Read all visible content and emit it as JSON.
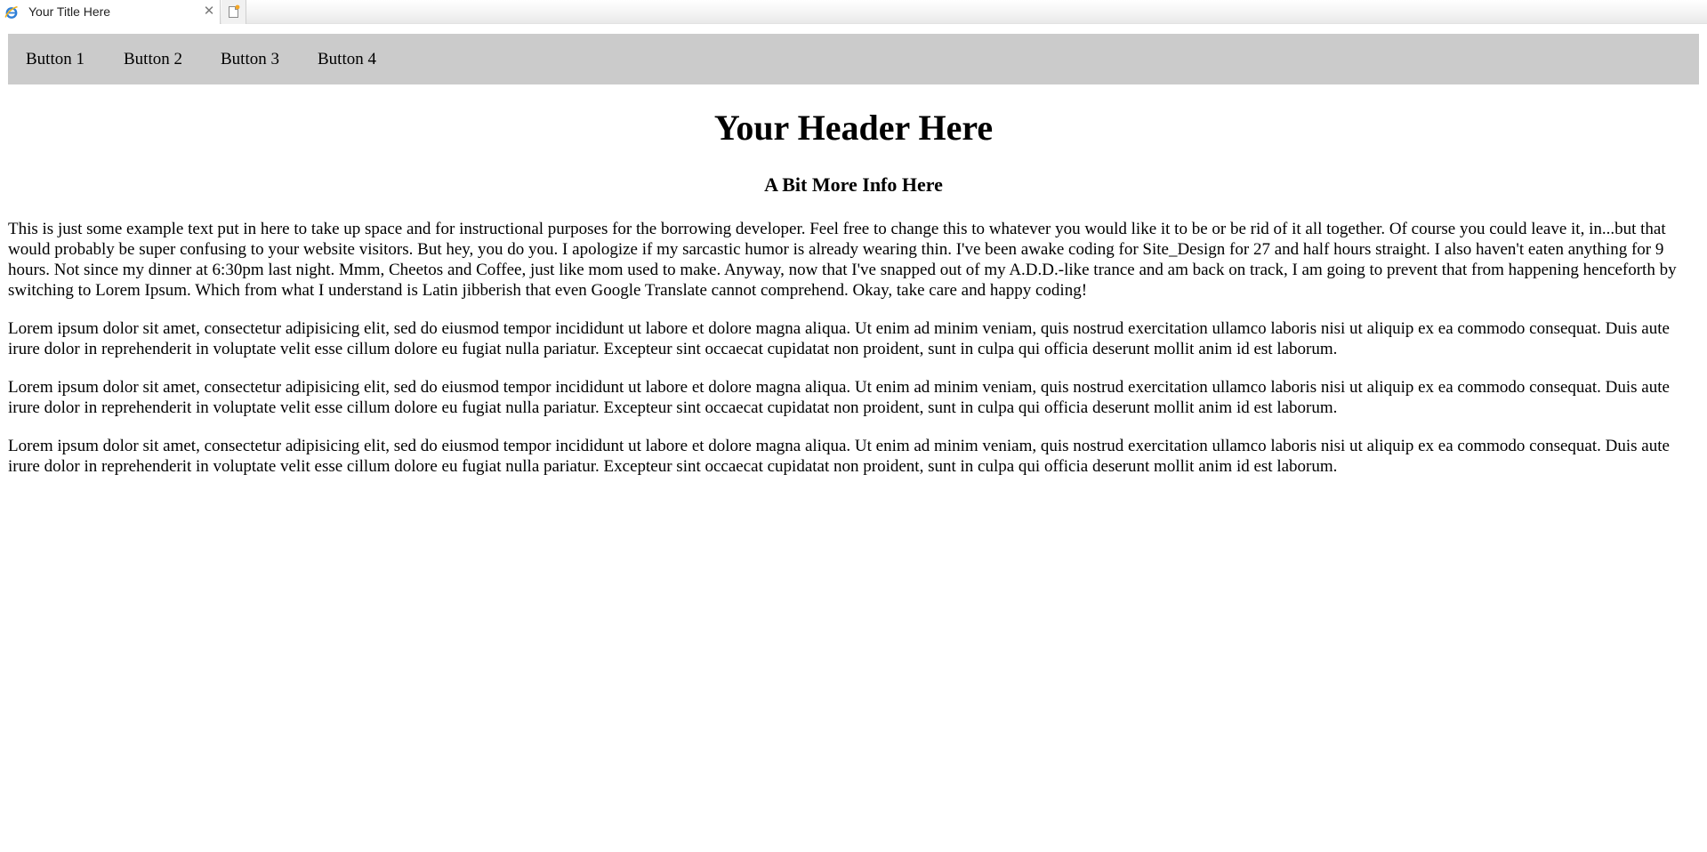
{
  "browser": {
    "tab_title": "Your Title Here",
    "tab_icon": "ie-logo-icon",
    "close_icon": "close-icon",
    "new_tab_icon": "new-tab-icon"
  },
  "nav": {
    "buttons": [
      "Button 1",
      "Button 2",
      "Button 3",
      "Button 4"
    ],
    "background": "#cbcbcb"
  },
  "header": "Your Header Here",
  "subheader": "A Bit More Info Here",
  "paragraphs": [
    "This is just some example text put in here to take up space and for instructional purposes for the borrowing developer. Feel free to change this to whatever you would like it to be or be rid of it all together. Of course you could leave it, in...but that would probably be super confusing to your website visitors. But hey, you do you. I apologize if my sarcastic humor is already wearing thin. I've been awake coding for Site_Design for 27 and half hours straight. I also haven't eaten anything for 9 hours. Not since my dinner at 6:30pm last night. Mmm, Cheetos and Coffee, just like mom used to make. Anyway, now that I've snapped out of my A.D.D.-like trance and am back on track, I am going to prevent that from happening henceforth by switching to Lorem Ipsum. Which from what I understand is Latin jibberish that even Google Translate cannot comprehend. Okay, take care and happy coding!",
    "Lorem ipsum dolor sit amet, consectetur adipisicing elit, sed do eiusmod tempor incididunt ut labore et dolore magna aliqua. Ut enim ad minim veniam, quis nostrud exercitation ullamco laboris nisi ut aliquip ex ea commodo consequat. Duis aute irure dolor in reprehenderit in voluptate velit esse cillum dolore eu fugiat nulla pariatur. Excepteur sint occaecat cupidatat non proident, sunt in culpa qui officia deserunt mollit anim id est laborum.",
    "Lorem ipsum dolor sit amet, consectetur adipisicing elit, sed do eiusmod tempor incididunt ut labore et dolore magna aliqua. Ut enim ad minim veniam, quis nostrud exercitation ullamco laboris nisi ut aliquip ex ea commodo consequat. Duis aute irure dolor in reprehenderit in voluptate velit esse cillum dolore eu fugiat nulla pariatur. Excepteur sint occaecat cupidatat non proident, sunt in culpa qui officia deserunt mollit anim id est laborum.",
    "Lorem ipsum dolor sit amet, consectetur adipisicing elit, sed do eiusmod tempor incididunt ut labore et dolore magna aliqua. Ut enim ad minim veniam, quis nostrud exercitation ullamco laboris nisi ut aliquip ex ea commodo consequat. Duis aute irure dolor in reprehenderit in voluptate velit esse cillum dolore eu fugiat nulla pariatur. Excepteur sint occaecat cupidatat non proident, sunt in culpa qui officia deserunt mollit anim id est laborum."
  ]
}
